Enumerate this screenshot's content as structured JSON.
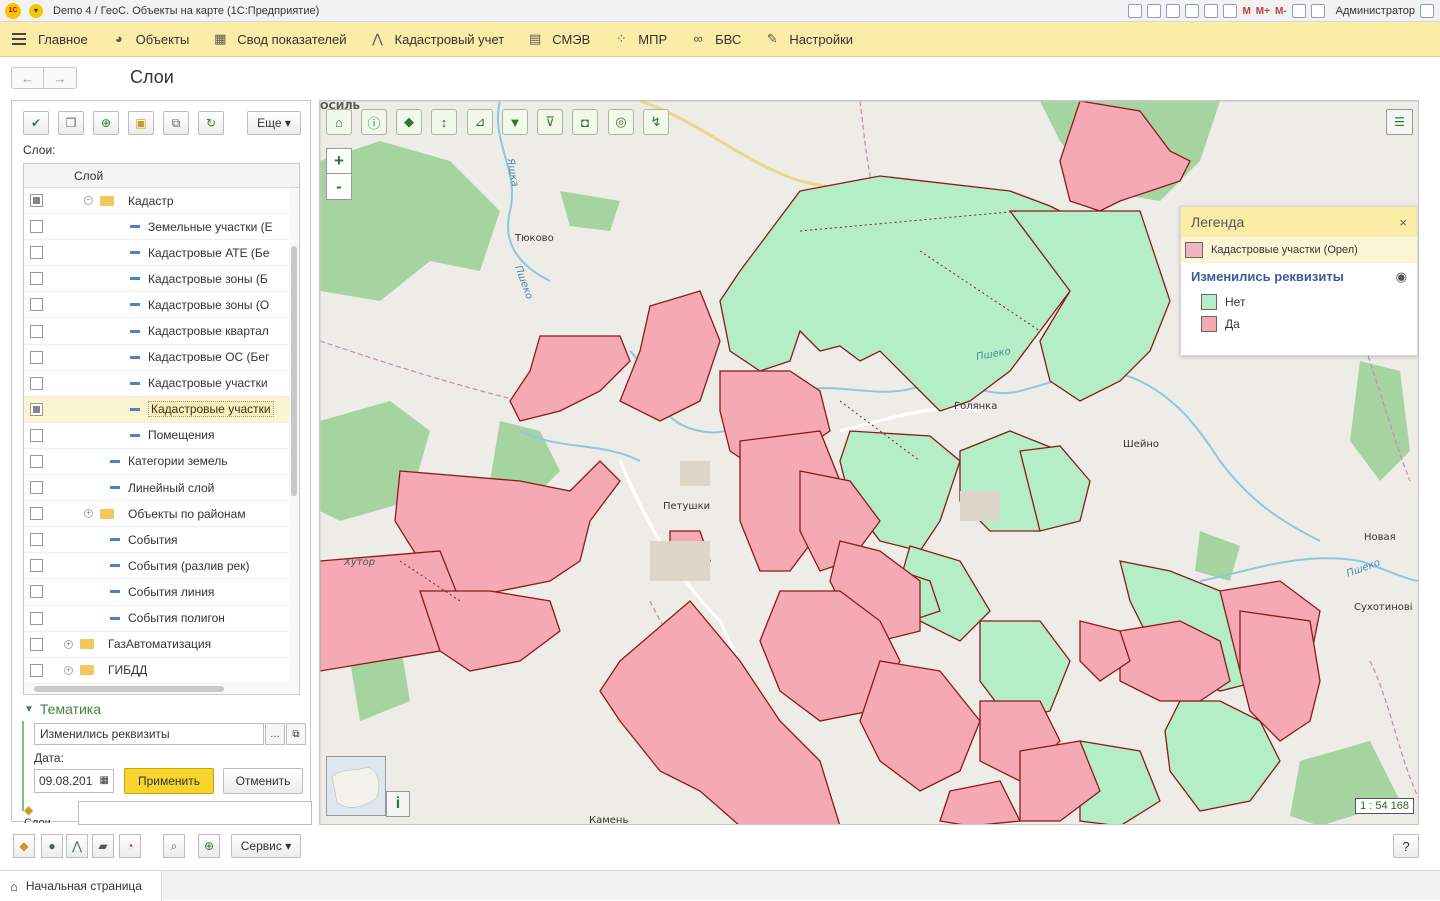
{
  "app": {
    "title": "Demo 4 / ГеоС. Объекты на карте   (1С:Предприятие)",
    "logo_text": "1С",
    "user": "Администратор",
    "toolbar_marks": [
      "M",
      "M+",
      "M-"
    ]
  },
  "sections": [
    {
      "label": "Главное",
      "icon": "menu-icon"
    },
    {
      "label": "Объекты",
      "icon": "globe-icon"
    },
    {
      "label": "Свод показателей",
      "icon": "table-icon"
    },
    {
      "label": "Кадастровый учет",
      "icon": "compass-icon"
    },
    {
      "label": "СМЭВ",
      "icon": "document-icon"
    },
    {
      "label": "МПР",
      "icon": "grid-icon"
    },
    {
      "label": "БВС",
      "icon": "link-icon"
    },
    {
      "label": "Настройки",
      "icon": "wrench-icon"
    }
  ],
  "form": {
    "title": "Слои",
    "more_label": "Еще",
    "layers_label": "Слои:",
    "grid_header": "Слой",
    "layers": [
      {
        "label": "Кадастр",
        "level": 1,
        "type": "folder",
        "expanded": true,
        "checked": "partial"
      },
      {
        "label": "Земельные участки (Е",
        "level": 2,
        "type": "layer",
        "checked": "none"
      },
      {
        "label": "Кадастровые АТЕ (Бе",
        "level": 2,
        "type": "layer",
        "checked": "none"
      },
      {
        "label": "Кадастровые зоны (Б",
        "level": 2,
        "type": "layer",
        "checked": "none"
      },
      {
        "label": "Кадастровые зоны (О",
        "level": 2,
        "type": "layer",
        "checked": "none"
      },
      {
        "label": "Кадастровые квартал",
        "level": 2,
        "type": "layer",
        "checked": "none"
      },
      {
        "label": "Кадастровые ОС (Бег",
        "level": 2,
        "type": "layer",
        "checked": "none"
      },
      {
        "label": "Кадастровые участки",
        "level": 2,
        "type": "layer",
        "checked": "none"
      },
      {
        "label": "Кадастровые участки",
        "level": 2,
        "type": "layer",
        "checked": "partial",
        "selected": true
      },
      {
        "label": "Помещения",
        "level": 2,
        "type": "layer",
        "checked": "none"
      },
      {
        "label": "Категории земель",
        "level": 1,
        "type": "layer",
        "checked": "none"
      },
      {
        "label": "Линейный слой",
        "level": 1,
        "type": "layer",
        "checked": "none"
      },
      {
        "label": "Объекты по районам",
        "level": 1,
        "type": "folder",
        "expanded": false,
        "checked": "none"
      },
      {
        "label": "События",
        "level": 1,
        "type": "layer",
        "checked": "none"
      },
      {
        "label": "События (разлив рек)",
        "level": 1,
        "type": "layer",
        "checked": "none"
      },
      {
        "label": "События линия",
        "level": 1,
        "type": "layer",
        "checked": "none"
      },
      {
        "label": "События полигон",
        "level": 1,
        "type": "layer",
        "checked": "none"
      },
      {
        "label": "ГазАвтоматизация",
        "level": 0,
        "type": "folder",
        "expanded": false,
        "checked": "none"
      },
      {
        "label": "ГИБДД",
        "level": 0,
        "type": "folder",
        "expanded": false,
        "checked": "none"
      }
    ],
    "thematic": {
      "header": "Тематика",
      "value": "Изменились реквизиты",
      "date_label": "Дата:",
      "date_value": "09.08.201",
      "apply_label": "Применить",
      "cancel_label": "Отменить",
      "bottom_fragment": "Слои"
    }
  },
  "map": {
    "zoom_in": "+",
    "zoom_out": "-",
    "scale": "1 : 54 168",
    "info_label": "i",
    "labels": [
      {
        "text": "Тюково"
      },
      {
        "text": "Голянка"
      },
      {
        "text": "Шейно"
      },
      {
        "text": "Петушки"
      },
      {
        "text": "Новая"
      },
      {
        "text": "Сухотинові"
      },
      {
        "text": "Хутор"
      },
      {
        "text": "Ящка"
      },
      {
        "text": "Пшеко"
      },
      {
        "text": "Пшеко"
      },
      {
        "text": "Пшеко"
      },
      {
        "text": "Камень"
      },
      {
        "text": "ОСИЛЬ"
      }
    ],
    "legend": {
      "title": "Легенда",
      "close": "×",
      "layer": "Кадастровые участки (Орел)",
      "theme": "Изменились реквизиты",
      "items": [
        {
          "label": "Нет",
          "color": "#b4eec6"
        },
        {
          "label": "Да",
          "color": "#f5a9b5"
        }
      ]
    },
    "colors": {
      "parcel_green": "#b4eec6",
      "parcel_pink": "#f5a9b5",
      "parcel_border": "#8b1a1a",
      "forest": "#a6d4a0",
      "river": "#8ec7df",
      "boundary": "#c58ab8",
      "road": "#f5e9a4"
    }
  },
  "bottom": {
    "service_label": "Сервис",
    "help_label": "?"
  },
  "windows": {
    "home_label": "Начальная страница"
  }
}
